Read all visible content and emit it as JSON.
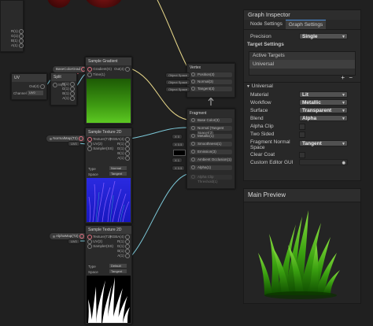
{
  "graph": {
    "left_node": {
      "ports": [
        "R(1)",
        "G(1)",
        "B(1)",
        "A(1)"
      ]
    },
    "uv_node": {
      "title": "UV",
      "channel_label": "Channel",
      "channel_value": "UV0",
      "out_label": "Out(4)"
    },
    "split_node": {
      "title": "Split",
      "in_label": "In(4)",
      "ports": [
        "R(1)",
        "G(1)",
        "B(1)",
        "A(1)"
      ]
    },
    "gradient_prop": {
      "label": "BaseColorGrad"
    },
    "sample_gradient": {
      "title": "Sample Gradient",
      "in_gradient": "Gradient(G)",
      "in_time": "Time(1)",
      "out": "Out(4)"
    },
    "normal_prop": {
      "label": "NormalMap(T2)"
    },
    "normal_uv": {
      "label": "UV0"
    },
    "sample_tex_1": {
      "title": "Sample Texture 2D",
      "inputs": [
        "Texture(T2)",
        "UV(2)",
        "Sampler(SS)"
      ],
      "outputs": [
        "RGBA(4)",
        "R(1)",
        "G(1)",
        "B(1)",
        "A(1)"
      ],
      "type_label": "Type",
      "type_value": "Normal",
      "space_label": "Space",
      "space_value": "Tangent"
    },
    "alpha_prop": {
      "label": "AlphaMap(T2)"
    },
    "alpha_uv": {
      "label": "UV0"
    },
    "sample_tex_2": {
      "title": "Sample Texture 2D",
      "inputs": [
        "Texture(T2)",
        "UV(2)",
        "Sampler(SS)"
      ],
      "outputs": [
        "RGBA(4)",
        "R(1)",
        "G(1)",
        "B(1)",
        "A(1)"
      ],
      "type_label": "Type",
      "type_value": "Default",
      "space_label": "Space",
      "space_value": "Tangent"
    },
    "vertex": {
      "title": "Vertex",
      "slots": [
        "Position(3)",
        "Normal(3)",
        "Tangent(3)"
      ],
      "inputs": [
        "Object Space",
        "Object Space",
        "Object Space"
      ]
    },
    "fragment": {
      "title": "Fragment",
      "slots": [
        "Base Color(3)",
        "Normal (Tangent Space)(3)",
        "Metallic(1)",
        "Smoothness(1)",
        "Emission(3)",
        "Ambient Occlusion(1)",
        "Alpha(1)",
        "Alpha Clip Threshold(1)"
      ],
      "inputs": [
        "X 0",
        "X 0.5",
        "",
        "X 1",
        "X 0.5"
      ]
    }
  },
  "inspector": {
    "title": "Graph Inspector",
    "tabs": [
      "Node Settings",
      "Graph Settings"
    ],
    "precision_label": "Precision",
    "precision_value": "Single",
    "target_settings_label": "Target Settings",
    "active_targets_label": "Active Targets",
    "active_target_item": "Universal",
    "add_glyph": "+",
    "remove_glyph": "−",
    "section_label": "Universal",
    "material_label": "Material",
    "material_value": "Lit",
    "workflow_label": "Workflow",
    "workflow_value": "Metallic",
    "surface_label": "Surface",
    "surface_value": "Transparent",
    "blend_label": "Blend",
    "blend_value": "Alpha",
    "alpha_clip_label": "Alpha Clip",
    "two_sided_label": "Two Sided",
    "frag_normal_label_1": "Fragment Normal",
    "frag_normal_label_2": "Space",
    "frag_normal_value": "Tangent",
    "clear_coat_label": "Clear Coat",
    "custom_gui_label": "Custom Editor GUI"
  },
  "preview": {
    "title": "Main Preview"
  },
  "colors": {
    "accent": "#4a8cd8",
    "wire_yellow": "#e8d88a",
    "wire_cyan": "#7cc8d8",
    "wire_pink": "#e07080"
  }
}
